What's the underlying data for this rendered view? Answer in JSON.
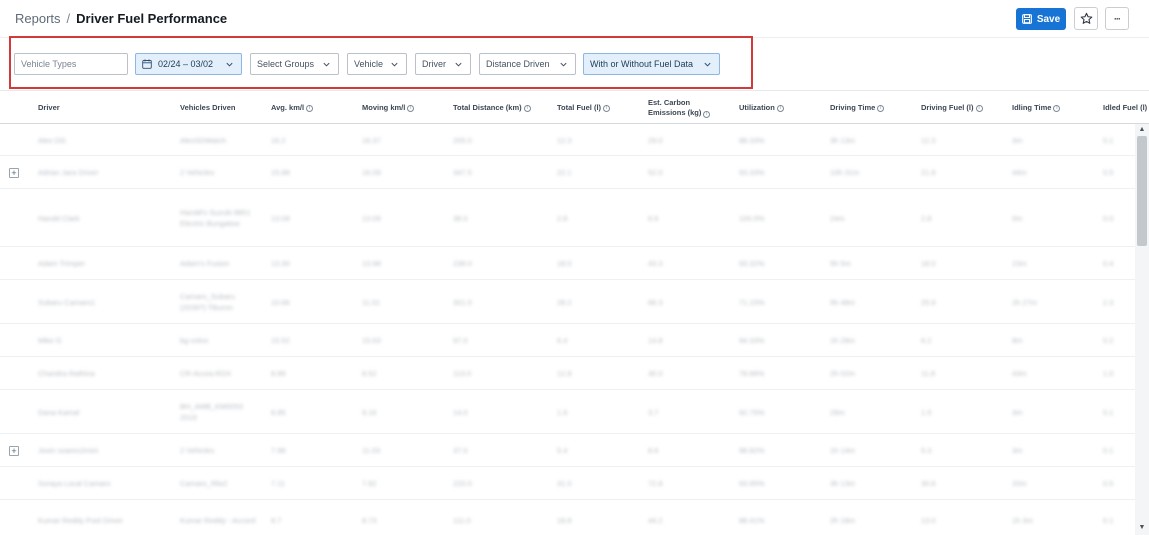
{
  "breadcrumb": {
    "parent": "Reports",
    "separator": "/",
    "current": "Driver Fuel Performance"
  },
  "toolbar": {
    "save_label": "Save",
    "more_label": "···",
    "star_icon": "star-outline-icon",
    "save_icon": "floppy-disk-icon"
  },
  "filters": {
    "vehicle_types_placeholder": "Vehicle Types",
    "date_range": "02/24 – 03/02",
    "groups": "Select Groups",
    "vehicle": "Vehicle",
    "driver": "Driver",
    "distance": "Distance Driven",
    "fuel_data": "With or Without Fuel Data"
  },
  "columns": {
    "driver": "Driver",
    "vehicles": "Vehicles Driven",
    "avg": "Avg. km/l",
    "moving": "Moving km/l",
    "distance": "Total Distance (km)",
    "fuel": "Total Fuel (l)",
    "carbon_1": "Est. Carbon",
    "carbon_2": "Emissions (kg)",
    "util": "Utilization",
    "dtime": "Driving Time",
    "dfuel": "Driving Fuel (l)",
    "itime": "Idling Time",
    "ifuel": "Idled Fuel (l)"
  },
  "rows": [
    {
      "driver": "Alex DG",
      "vehicles": "AlexSDWatch",
      "avg": "16.2",
      "moving": "16.37",
      "distance": "205.0",
      "fuel": "12.3",
      "carbon": "29.0",
      "util": "88.33%",
      "dtime": "3h 13m",
      "dfuel": "12.3",
      "itime": "3m",
      "ifuel": "0.1"
    },
    {
      "driver": "Adrian Jara Driver",
      "vehicles": "2 Vehicles",
      "avg": "15.88",
      "moving": "16.09",
      "distance": "347.5",
      "fuel": "22.1",
      "carbon": "52.0",
      "util": "93.33%",
      "dtime": "10h 31m",
      "dfuel": "21.8",
      "itime": "44m",
      "ifuel": "0.5"
    },
    {
      "driver": "Harold Clark",
      "vehicles": "Harold's Suzuki 8851 Electric Bungalow",
      "avg": "13.09",
      "moving": "13.09",
      "distance": "38.0",
      "fuel": "2.8",
      "carbon": "6.6",
      "util": "100.0%",
      "dtime": "24m",
      "dfuel": "2.8",
      "itime": "0m",
      "ifuel": "0.0"
    },
    {
      "driver": "Adam Trimper",
      "vehicles": "Adam's Fusion",
      "avg": "13.30",
      "moving": "13.68",
      "distance": "238.0",
      "fuel": "18.0",
      "carbon": "43.3",
      "util": "93.32%",
      "dtime": "5h 5m",
      "dfuel": "18.0",
      "itime": "23m",
      "ifuel": "0.4"
    },
    {
      "driver": "Subaru Camaro1",
      "vehicles": "Camaro_Subaru (2039?) Tiburon",
      "avg": "10.66",
      "moving": "11.01",
      "distance": "301.0",
      "fuel": "28.2",
      "carbon": "66.3",
      "util": "71.15%",
      "dtime": "5h 48m",
      "dfuel": "25.9",
      "itime": "2h 27m",
      "ifuel": "2.3"
    },
    {
      "driver": "Mike G",
      "vehicles": "bg-volvo",
      "avg": "15.52",
      "moving": "15.63",
      "distance": "97.0",
      "fuel": "6.4",
      "carbon": "14.8",
      "util": "94.33%",
      "dtime": "1h 28m",
      "dfuel": "6.2",
      "itime": "8m",
      "ifuel": "0.2"
    },
    {
      "driver": "Chandra Rathina",
      "vehicles": "CR-Acura-RDX",
      "avg": "8.89",
      "moving": "8.52",
      "distance": "113.0",
      "fuel": "12.8",
      "carbon": "30.0",
      "util": "78.88%",
      "dtime": "2h 02m",
      "dfuel": "11.8",
      "itime": "43m",
      "ifuel": "1.0"
    },
    {
      "driver": "Dana Kamal",
      "vehicles": "BH_AMB_KM0053 2019",
      "avg": "8.85",
      "moving": "9.16",
      "distance": "14.0",
      "fuel": "1.6",
      "carbon": "3.7",
      "util": "92.75%",
      "dtime": "29m",
      "dfuel": "1.5",
      "itime": "3m",
      "ifuel": "0.1"
    },
    {
      "driver": "Jovin soares2mini",
      "vehicles": "2 Vehicles",
      "avg": "7.98",
      "moving": "11.03",
      "distance": "37.0",
      "fuel": "5.4",
      "carbon": "8.6",
      "util": "98.82%",
      "dtime": "1h 14m",
      "dfuel": "5.3",
      "itime": "3m",
      "ifuel": "0.1"
    },
    {
      "driver": "Soraya Local Camaro",
      "vehicles": "Camaro_Rlw2",
      "avg": "7.11",
      "moving": "7.82",
      "distance": "220.0",
      "fuel": "31.0",
      "carbon": "72.8",
      "util": "93.95%",
      "dtime": "3h 13m",
      "dfuel": "30.6",
      "itime": "20m",
      "ifuel": "0.5"
    },
    {
      "driver": "Kumar Reddy Pool Driver",
      "vehicles": "Kumar Reddy - Accord",
      "avg": "8.7",
      "moving": "8.73",
      "distance": "111.0",
      "fuel": "18.8",
      "carbon": "44.2",
      "util": "88.41%",
      "dtime": "2h 18m",
      "dfuel": "13.0",
      "itime": "1h 3m",
      "ifuel": "0.1"
    }
  ],
  "expandable_rows": [
    1,
    8
  ],
  "expand_symbol": "+",
  "scrollbar": {
    "up": "▲",
    "down": "▼"
  }
}
